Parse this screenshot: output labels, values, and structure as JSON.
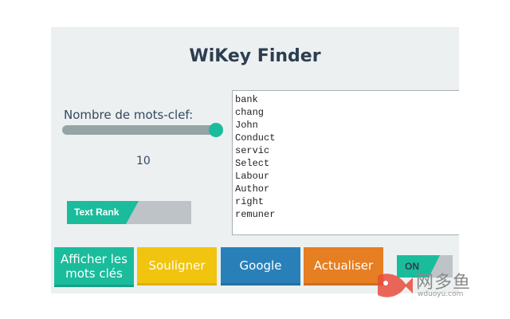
{
  "app": {
    "title": "WiKey Finder"
  },
  "settings": {
    "count_label": "Nombre de mots-clef:",
    "count_value": "10",
    "slider_fraction": 1.0,
    "rank_toggle_label": "Text Rank"
  },
  "keywords": [
    "bank",
    "chang",
    "John",
    "Conduct",
    "servic",
    "Select",
    "Labour",
    "Author",
    "right",
    "remuner"
  ],
  "buttons": {
    "show_label": "Afficher les mots clés",
    "underline_label": "Souligner",
    "google_label": "Google",
    "refresh_label": "Actualiser",
    "power_label": "ON"
  },
  "watermark": {
    "cn": "网多鱼",
    "url": "wduoyu.com"
  },
  "colors": {
    "teal": "#1abc9c",
    "yellow": "#f1c40f",
    "blue": "#2980b9",
    "orange": "#e67e22",
    "panel": "#ecf0f1"
  }
}
